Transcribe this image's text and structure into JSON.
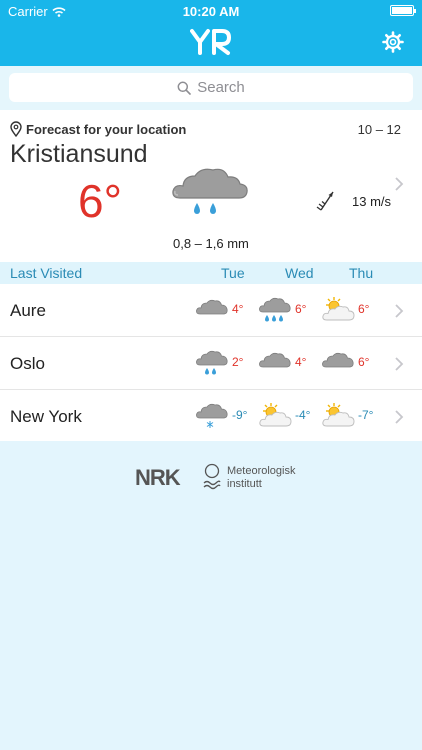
{
  "status": {
    "carrier": "Carrier",
    "time": "10:20 AM"
  },
  "header": {
    "logo": "YR"
  },
  "search": {
    "placeholder": "Search"
  },
  "forecast": {
    "heading": "Forecast for your location",
    "hours": "10 – 12",
    "city": "Kristiansund",
    "temperature": "6°",
    "precipitation": "0,8 – 1,6 mm",
    "wind": "13 m/s"
  },
  "last_visited": {
    "title": "Last Visited",
    "days": [
      "Tue",
      "Wed",
      "Thu"
    ],
    "rows": [
      {
        "name": "Aure",
        "cells": [
          {
            "icon": "cloud-icon",
            "temp": "4°",
            "kind": "warm"
          },
          {
            "icon": "rain-cloud-icon",
            "temp": "6°",
            "kind": "warm"
          },
          {
            "icon": "partly-sunny-icon",
            "temp": "6°",
            "kind": "warm"
          }
        ]
      },
      {
        "name": "Oslo",
        "cells": [
          {
            "icon": "light-rain-cloud-icon",
            "temp": "2°",
            "kind": "warm"
          },
          {
            "icon": "cloud-icon",
            "temp": "4°",
            "kind": "warm"
          },
          {
            "icon": "cloud-icon",
            "temp": "6°",
            "kind": "warm"
          }
        ]
      },
      {
        "name": "New York",
        "cells": [
          {
            "icon": "snow-cloud-icon",
            "temp": "-9°",
            "kind": "cold"
          },
          {
            "icon": "partly-sunny-icon",
            "temp": "-4°",
            "kind": "cold"
          },
          {
            "icon": "partly-sunny-icon",
            "temp": "-7°",
            "kind": "cold"
          }
        ]
      }
    ]
  },
  "footer": {
    "nrk": "NRK",
    "met_line1": "Meteorologisk",
    "met_line2": "institutt"
  },
  "colors": {
    "accent": "#19b6ea",
    "warm": "#e0332a",
    "cold": "#2a8bb5"
  }
}
